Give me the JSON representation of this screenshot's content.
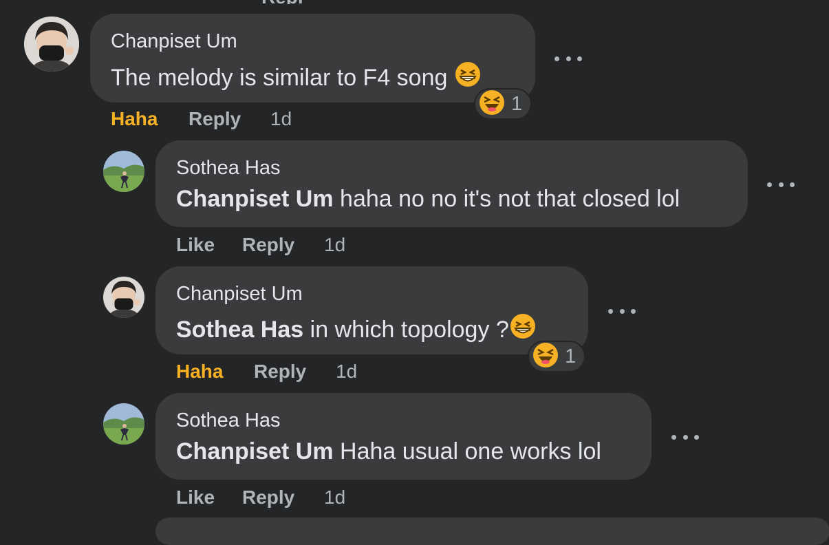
{
  "comments": [
    {
      "author": "Chanpiset Um",
      "tag": "",
      "text": "The melody is similar to F4 song",
      "reaction_label": "Haha",
      "reply_label": "Reply",
      "time": "1d",
      "reaction_count": "1",
      "avatar": "masked-person-avatar",
      "inline_emoji": "grinning-squinting-face-icon"
    },
    {
      "author": "Sothea Has",
      "tag": "Chanpiset Um",
      "text": " haha no no it's not that closed lol",
      "reaction_label": "Like",
      "reply_label": "Reply",
      "time": "1d",
      "avatar": "landscape-person-avatar"
    },
    {
      "author": "Chanpiset Um",
      "tag": "Sothea Has",
      "text": " in which topology ?",
      "reaction_label": "Haha",
      "reply_label": "Reply",
      "time": "1d",
      "reaction_count": "1",
      "avatar": "masked-person-avatar",
      "inline_emoji": "grinning-squinting-face-icon"
    },
    {
      "author": "Sothea Has",
      "tag": "Chanpiset Um",
      "text": " Haha usual one works lol",
      "reaction_label": "Like",
      "reply_label": "Reply",
      "time": "1d",
      "avatar": "landscape-person-avatar"
    }
  ],
  "colors": {
    "background": "#242526",
    "bubble": "#3a3b3c",
    "primary_text": "#e4e6eb",
    "secondary_text": "#b0b3b8",
    "haha_active": "#f7b125"
  }
}
